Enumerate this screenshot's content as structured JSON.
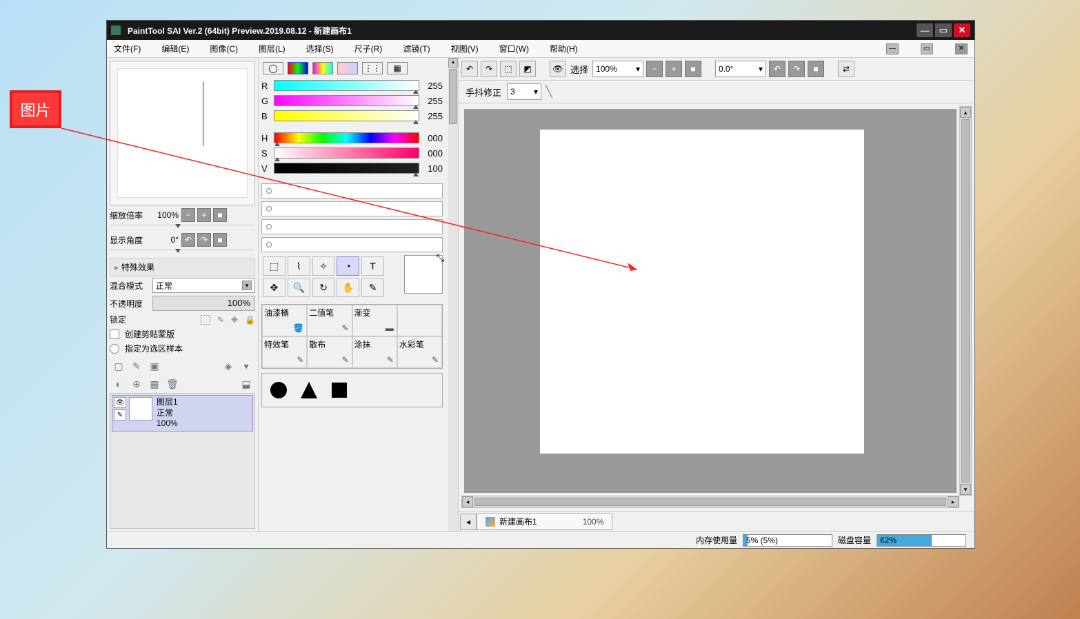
{
  "annotation": "图片",
  "title": "PaintTool SAI Ver.2 (64bit) Preview.2019.08.12 - 新建画布1",
  "menu": [
    "文件(F)",
    "编辑(E)",
    "图像(C)",
    "图层(L)",
    "选择(S)",
    "尺子(R)",
    "滤镜(T)",
    "视图(V)",
    "窗口(W)",
    "帮助(H)"
  ],
  "nav": {
    "zoom_lbl": "缩放倍率",
    "zoom_val": "100%",
    "angle_lbl": "显示角度",
    "angle_val": "0°"
  },
  "fx_header": "特殊效果",
  "blend": {
    "lbl": "混合模式",
    "val": "正常"
  },
  "opacity": {
    "lbl": "不透明度",
    "val": "100%"
  },
  "lock_lbl": "锁定",
  "clip_lbl": "创建剪贴蒙版",
  "sample_lbl": "指定为选区样本",
  "layer": {
    "name": "图层1",
    "mode": "正常",
    "op": "100%"
  },
  "rgb": {
    "r": "255",
    "g": "255",
    "b": "255",
    "h": "000",
    "s": "000",
    "v": "100"
  },
  "brushes": [
    "油漆桶",
    "二值笔",
    "渐变",
    "",
    "特效笔",
    "散布",
    "涂抹",
    "水彩笔"
  ],
  "toolbar": {
    "sel_lbl": "选择",
    "zoom": "100%",
    "angle": "0.0°"
  },
  "stab": {
    "lbl": "手抖修正",
    "val": "3"
  },
  "doc": {
    "name": "新建画布1",
    "zoom": "100%"
  },
  "status": {
    "mem_lbl": "内存使用量",
    "mem": "5% (5%)",
    "disk_lbl": "磁盘容量",
    "disk": "62%"
  }
}
